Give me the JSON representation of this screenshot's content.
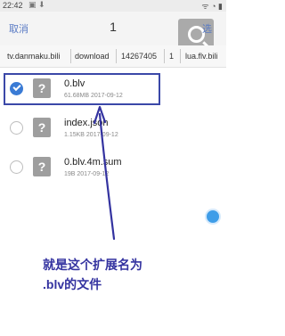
{
  "status_bar": {
    "time": "22:42",
    "left_icons": "▣ ⬇",
    "right_icons": "ᯤ ◔ ▮"
  },
  "header": {
    "cancel_label": "取消",
    "selected_count": "1",
    "select_label": "选"
  },
  "breadcrumb": [
    "tv.danmaku.bili",
    "download",
    "14267405",
    "1",
    "lua.flv.bili"
  ],
  "files": [
    {
      "name": "0.blv",
      "meta": "61.68MB  2017-09-12",
      "checked": true
    },
    {
      "name": "index.json",
      "meta": "1.15KB  2017-09-12",
      "checked": false
    },
    {
      "name": "0.blv.4m.sum",
      "meta": "19B  2017-09-12",
      "checked": false
    }
  ],
  "file_icon_glyph": "?",
  "annotation": {
    "line1": "就是这个扩展名为",
    "line2": ".blv的文件",
    "color": "#3433a0"
  },
  "colors": {
    "accent": "#3a7bd5",
    "highlight": "#3b48a8"
  }
}
